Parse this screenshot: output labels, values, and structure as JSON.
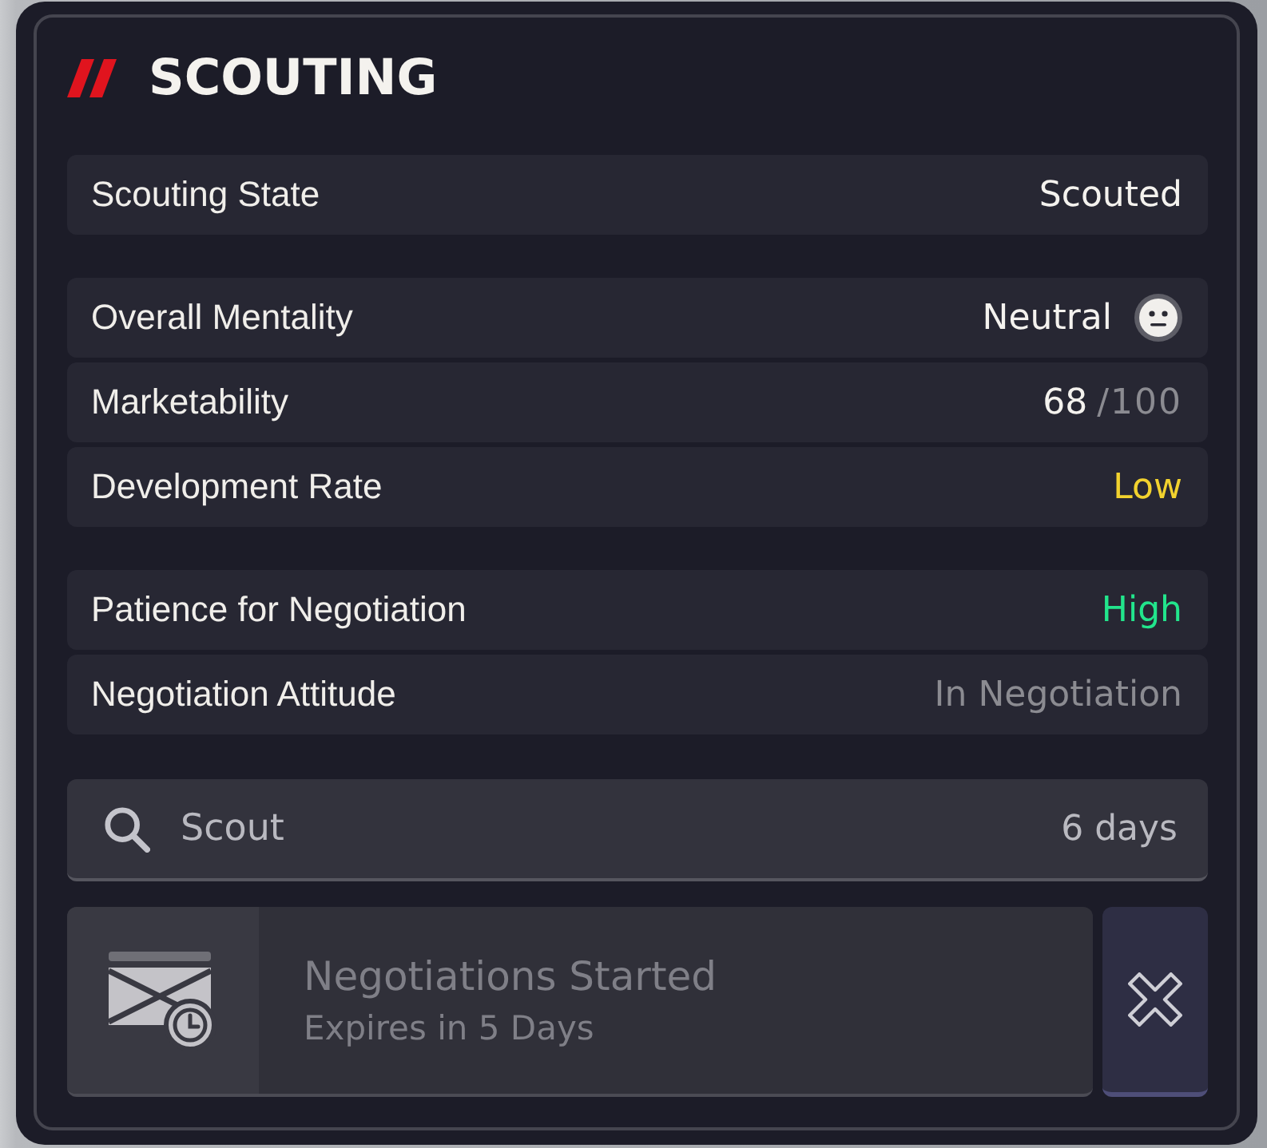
{
  "panel": {
    "title": "SCOUTING"
  },
  "groups": [
    {
      "rows": [
        {
          "kind": "text",
          "label": "Scouting State",
          "value": "Scouted",
          "color": "#f4f2ee"
        }
      ]
    },
    {
      "rows": [
        {
          "kind": "mood",
          "label": "Overall Mentality",
          "value": "Neutral",
          "color": "#f4f2ee"
        },
        {
          "kind": "score",
          "label": "Marketability",
          "value": "68",
          "out_of": "/100",
          "color": "#f4f2ee"
        },
        {
          "kind": "text",
          "label": "Development Rate",
          "value": "Low",
          "color": "#f2d22e"
        }
      ]
    },
    {
      "rows": [
        {
          "kind": "text",
          "label": "Patience for Negotiation",
          "value": "High",
          "color": "#22e58c"
        },
        {
          "kind": "text",
          "label": "Negotiation Attitude",
          "value": "In Negotiation",
          "color": "#8b8b91"
        }
      ]
    }
  ],
  "scout_action": {
    "label": "Scout",
    "duration": "6 days"
  },
  "notification": {
    "title": "Negotiations Started",
    "subtitle": "Expires in 5 Days"
  }
}
